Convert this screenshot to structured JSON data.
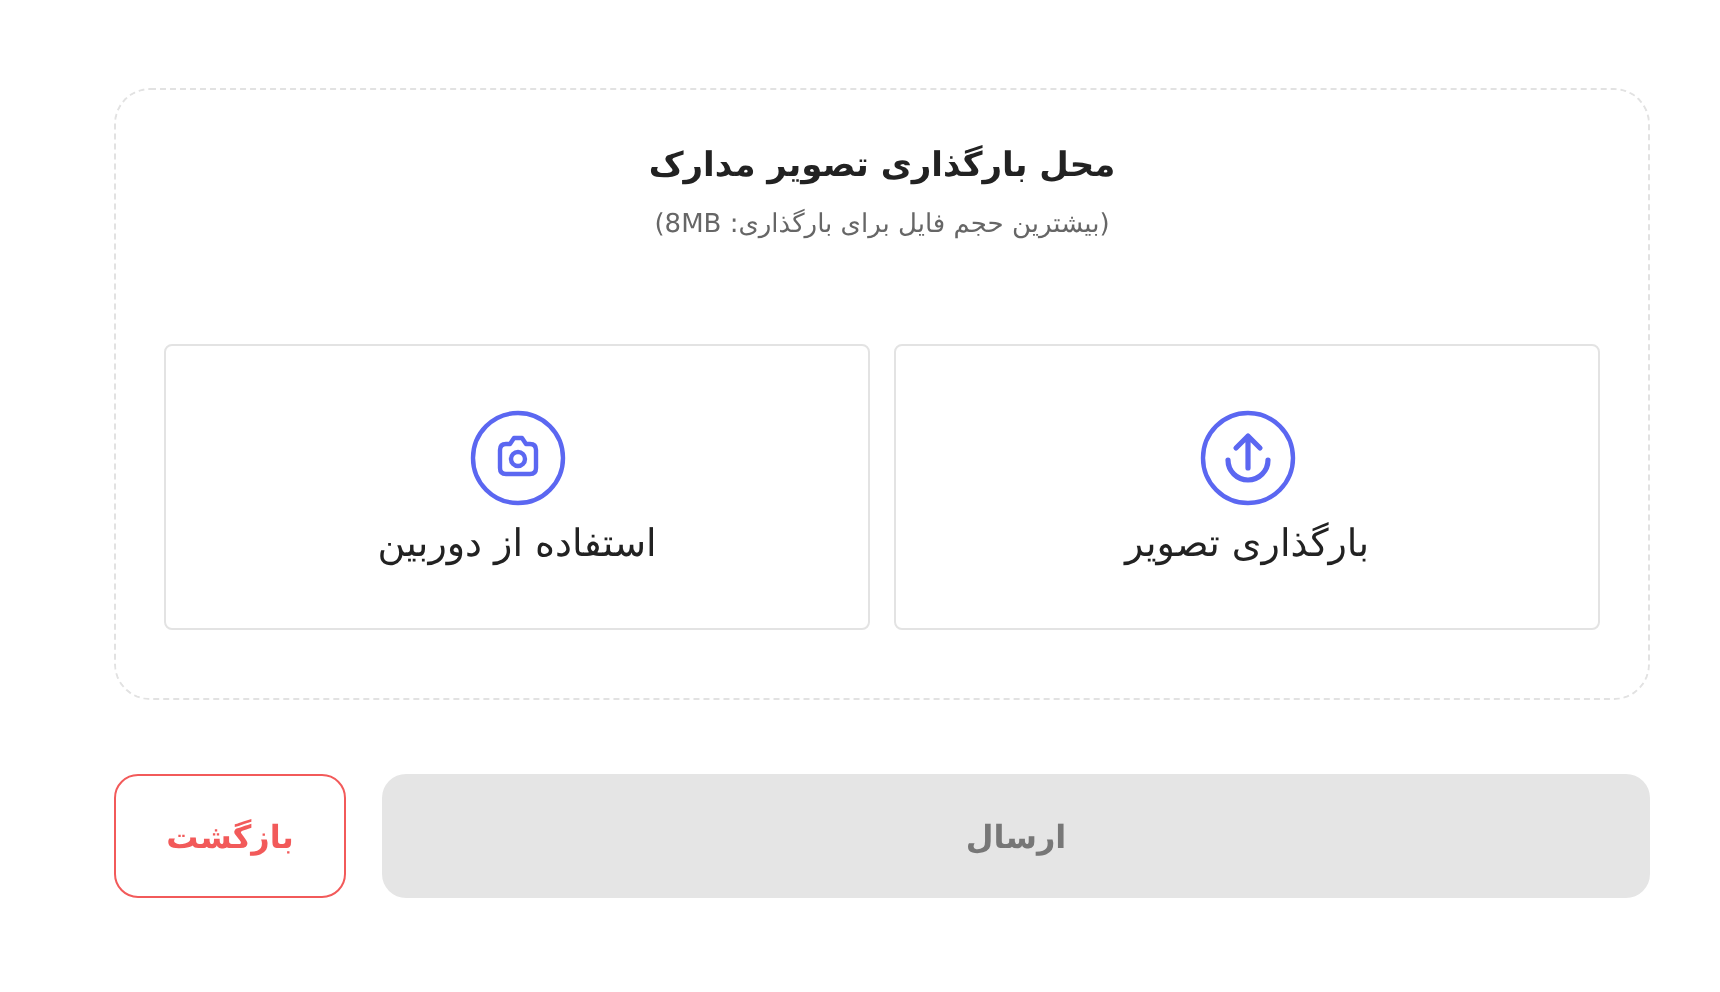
{
  "upload_area": {
    "title": "محل بارگذاری تصویر مدارک",
    "subtitle": "(بیشترین حجم فایل برای بارگذاری: 8MB)",
    "options": [
      {
        "kind": "upload",
        "label": "بارگذاری تصویر"
      },
      {
        "kind": "camera",
        "label": "استفاده از دوربین"
      }
    ]
  },
  "actions": {
    "submit": {
      "label": "ارسال",
      "disabled": true
    },
    "back": {
      "label": "بازگشت"
    }
  }
}
